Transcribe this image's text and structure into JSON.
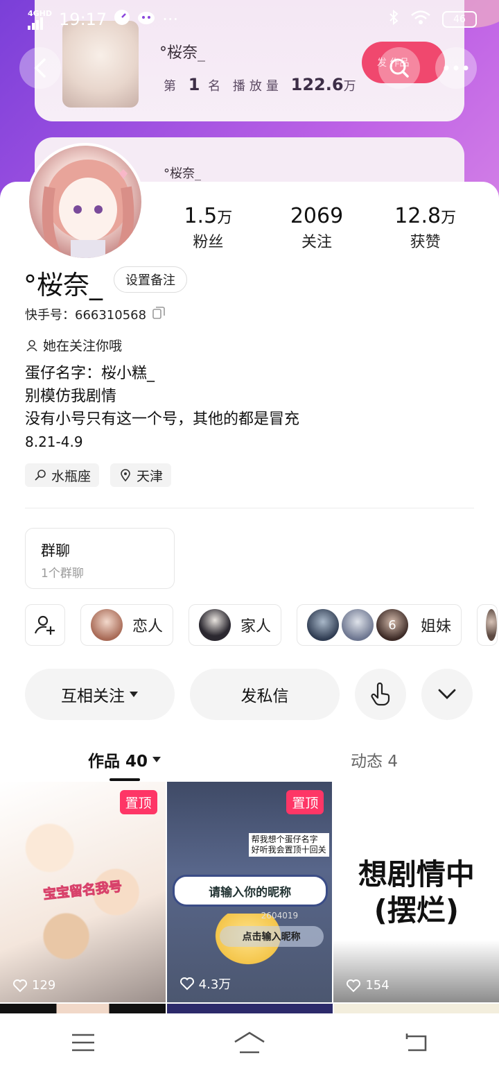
{
  "status_bar": {
    "network": "4GHD",
    "time": "19:17",
    "battery": "46"
  },
  "banner": {
    "name": "°桜奈_",
    "rank_prefix": "第",
    "rank_number": "1",
    "rank_middle": "名 播放量",
    "plays": "122.6",
    "plays_unit": "万",
    "pill_text": "发 作品"
  },
  "banner2": {
    "name": "°桜奈_"
  },
  "stats": [
    {
      "num": "1.5",
      "unit": "万",
      "label": "粉丝"
    },
    {
      "num": "2069",
      "unit": "",
      "label": "关注"
    },
    {
      "num": "12.8",
      "unit": "万",
      "label": "获赞"
    }
  ],
  "profile": {
    "username": "°桜奈_",
    "remark_button": "设置备注",
    "ks_id": "快手号：666310568",
    "follow_note": "她在关注你哦",
    "bio": [
      "蛋仔名字：桜小糕_",
      "别模仿我剧情",
      "没有小号只有这一个号，其他的都是冒充",
      "8.21-4.9"
    ],
    "tags": [
      "水瓶座",
      "天津"
    ]
  },
  "group": {
    "title": "群聊",
    "subtitle": "1个群聊"
  },
  "relations": [
    {
      "label": "恋人"
    },
    {
      "label": "家人"
    },
    {
      "label": "姐妹",
      "badge": "6"
    }
  ],
  "actions": {
    "mutual_follow": "互相关注",
    "message": "发私信"
  },
  "tabs": {
    "works": "作品 40",
    "moments": "动态 4"
  },
  "videos": [
    {
      "pinned": "置顶",
      "sticker": "宝宝留名我号",
      "likes": "129"
    },
    {
      "pinned": "置顶",
      "note_line1": "帮我想个蛋仔名字",
      "note_line2": "好听我会置顶十回关",
      "input_text": "请输入你的昵称",
      "partial_code": "2604019",
      "button_text": "点击输入昵称",
      "likes": "4.3万"
    },
    {
      "text_line1": "想剧情中",
      "text_line2": "(摆烂)",
      "likes": "154"
    }
  ],
  "colors": {
    "accent_pink": "#fe3666",
    "header_purple": "#8a45dc"
  }
}
